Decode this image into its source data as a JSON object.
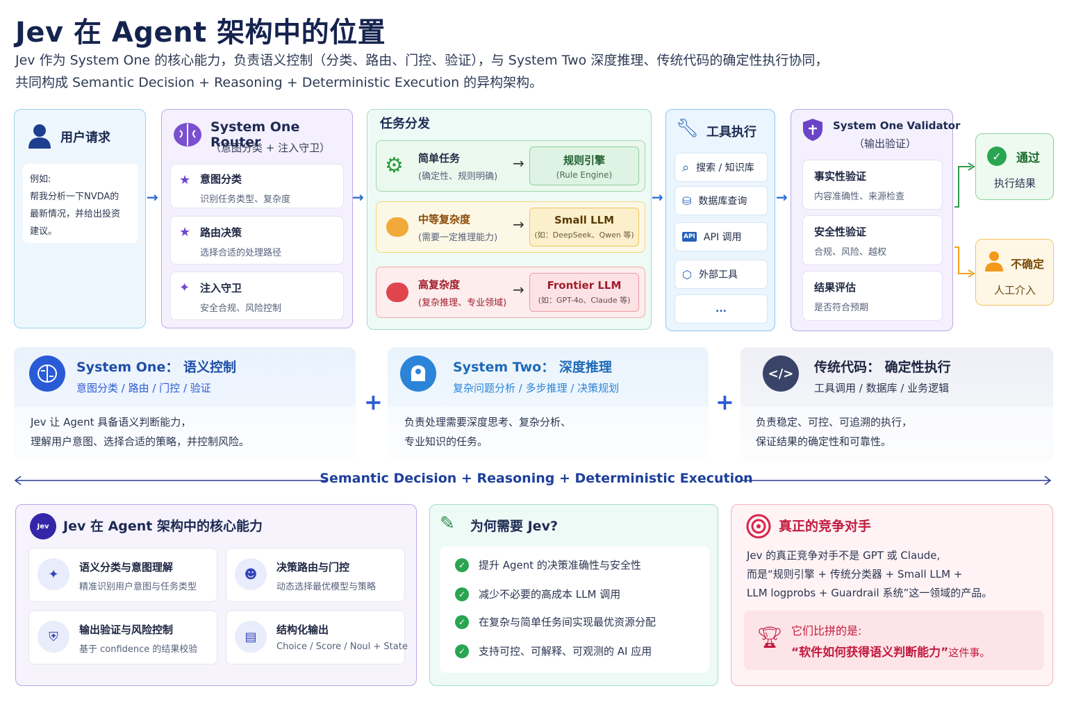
{
  "title": "Jev 在 Agent 架构中的位置",
  "subtitle1": "Jev 作为 System One 的核心能力，负责语义控制（分类、路由、门控、验证），与 System Two 深度推理、传统代码的确定性执行协同，",
  "subtitle2": "共同构成 Semantic Decision + Reasoning + Deterministic Execution 的异构架构。",
  "user": {
    "title": "用户请求",
    "example_label": "例如:",
    "example_text": [
      "帮我分析一下NVDA的",
      "最新情况，并给出投资",
      "建议。"
    ]
  },
  "router": {
    "title": "System One Router",
    "subtitle": "（意图分类 + 注入守卫）",
    "items": [
      {
        "t": "意图分类",
        "s": "识别任务类型、复杂度"
      },
      {
        "t": "路由决策",
        "s": "选择合适的处理路径"
      },
      {
        "t": "注入守卫",
        "s": "安全合规、风险控制"
      }
    ]
  },
  "dispatch": {
    "title": "任务分发",
    "rows": [
      {
        "t": "简单任务",
        "s": "(确定性、规则明确)",
        "e": "规则引擎",
        "es": "(Rule Engine)"
      },
      {
        "t": "中等复杂度",
        "s": "(需要一定推理能力)",
        "e": "Small LLM",
        "es": "(如：DeepSeek、Qwen 等)"
      },
      {
        "t": "高复杂度",
        "s": "(复杂推理、专业领域)",
        "e": "Frontier LLM",
        "es": "(如：GPT-4o、Claude 等)"
      }
    ]
  },
  "tools": {
    "title": "工具执行",
    "items": [
      "搜索 / 知识库",
      "数据库查询",
      "API 调用",
      "外部工具",
      "..."
    ],
    "api_badge": "API"
  },
  "validator": {
    "title": "System One Validator",
    "subtitle": "（输出验证）",
    "items": [
      {
        "t": "事实性验证",
        "s": "内容准确性、来源检查"
      },
      {
        "t": "安全性验证",
        "s": "合规、风险、越权"
      },
      {
        "t": "结果评估",
        "s": "是否符合预期"
      }
    ]
  },
  "pass": {
    "t": "通过",
    "s": "执行结果"
  },
  "uncertain": {
    "t": "不确定",
    "s": "人工介入"
  },
  "sys1": {
    "title": "System One： 语义控制",
    "tags": "意图分类 / 路由 / 门控 / 验证",
    "body1": "Jev 让 Agent 具备语义判断能力，",
    "body2": "理解用户意图、选择合适的策略，并控制风险。"
  },
  "sys2": {
    "title": "System Two： 深度推理",
    "tags": "复杂问题分析 / 多步推理 / 决策规划",
    "body1": "负责处理需要深度思考、复杂分析、",
    "body2": "专业知识的任务。"
  },
  "code": {
    "title": "传统代码： 确定性执行",
    "tags": "工具调用 / 数据库 / 业务逻辑",
    "body1": "负责稳定、可控、可追溯的执行，",
    "body2": "保证结果的确定性和可靠性。"
  },
  "plus": "+",
  "axis": "Semantic Decision + Reasoning + Deterministic Execution",
  "core": {
    "title": "Jev  在 Agent 架构中的核心能力",
    "logo": "Jev",
    "items": [
      {
        "t": "语义分类与意图理解",
        "s": "精准识别用户意图与任务类型"
      },
      {
        "t": "决策路由与门控",
        "s": "动态选择最优模型与策略"
      },
      {
        "t": "输出验证与风险控制",
        "s": "基于 confidence 的结果校验"
      },
      {
        "t": "结构化输出",
        "s": "Choice / Score / Noul + State"
      }
    ]
  },
  "why": {
    "title": "为何需要 Jev?",
    "items": [
      "提升 Agent 的决策准确性与安全性",
      "减少不必要的高成本 LLM 调用",
      "在复杂与简单任务间实现最优资源分配",
      "支持可控、可解释、可观测的 AI 应用"
    ]
  },
  "rival": {
    "title": "真正的竞争对手",
    "l1": "Jev 的真正竞争对手不是 GPT 或 Claude,",
    "l2": "而是“规则引擎 + 传统分类器 + Small LLM +",
    "l3": "LLM logprobs + Guardrail 系统”这一领域的产品。",
    "q1": "它们比拼的是:",
    "q2": "“软件如何获得语义判断能力”",
    "q3": "这件事。"
  }
}
